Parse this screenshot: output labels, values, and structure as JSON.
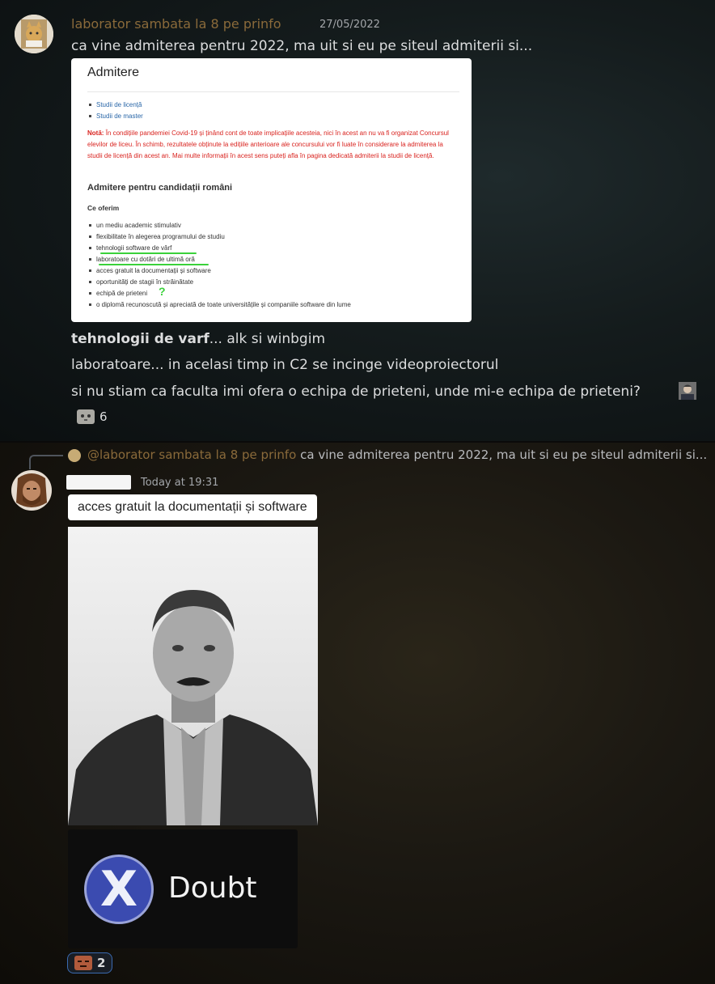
{
  "message1": {
    "author": "laborator sambata la 8 pe prinfo",
    "timestamp": "27/05/2022",
    "text": "ca vine admiterea pentru 2022, ma uit si eu pe siteul admiterii si...",
    "embed": {
      "title": "Admitere",
      "links": [
        "Studii de licență",
        "Studii de master"
      ],
      "note_label": "Notă:",
      "note_text": "În condițiile pandemiei Covid-19 și ținând cont de toate implicațiile acesteia, nici în acest an nu va fi organizat Concursul elevilor de liceu. În schimb, rezultatele obținute la edițiile anterioare ale concursului vor fi luate în considerare la admiterea la studii de licență din acest an. Mai multe informații în acest sens puteți afla în pagina dedicată admiterii la studii de licență.",
      "heading": "Admitere pentru candidații români",
      "subheading": "Ce oferim",
      "offers": [
        "un mediu academic stimulativ",
        "flexibilitate în alegerea programului de studiu",
        "tehnologii software de vârf",
        "laboratoare cu dotări de ultimă oră",
        "acces gratuit la documentații și software",
        "oportunități de stagii în străinătate",
        "echipă de prieteni",
        "o diplomă recunoscută și apreciată de toate universitățile și companiile software din lume"
      ],
      "question_mark": "?"
    },
    "follow_bold": "tehnologii de varf",
    "follow_rest": "... alk si winbgim",
    "line2": "laboratoare... in acelasi timp in C2 se incinge videoproiectorul",
    "line3": "si nu stiam ca faculta imi ofera o echipa de prieteni, unde mi-e echipa de prieteni?",
    "reaction_count": "6"
  },
  "message2": {
    "reply_mention": "@laborator sambata la 8 pe prinfo",
    "reply_text": "ca vine admiterea pentru 2022, ma uit si eu pe siteul admiterii si...",
    "timestamp": "Today at 19:31",
    "caption": "acces gratuit la documentații și software",
    "doubt_letter": "X",
    "doubt_word": "Doubt",
    "reaction_count": "2"
  },
  "colors": {
    "username": "#8a6a3a",
    "text": "#dcddde",
    "note_red": "#d9231f",
    "link_blue": "#2a67a8",
    "highlight_green": "#3ad13a",
    "doubt_circle": "#3b4bb0"
  }
}
